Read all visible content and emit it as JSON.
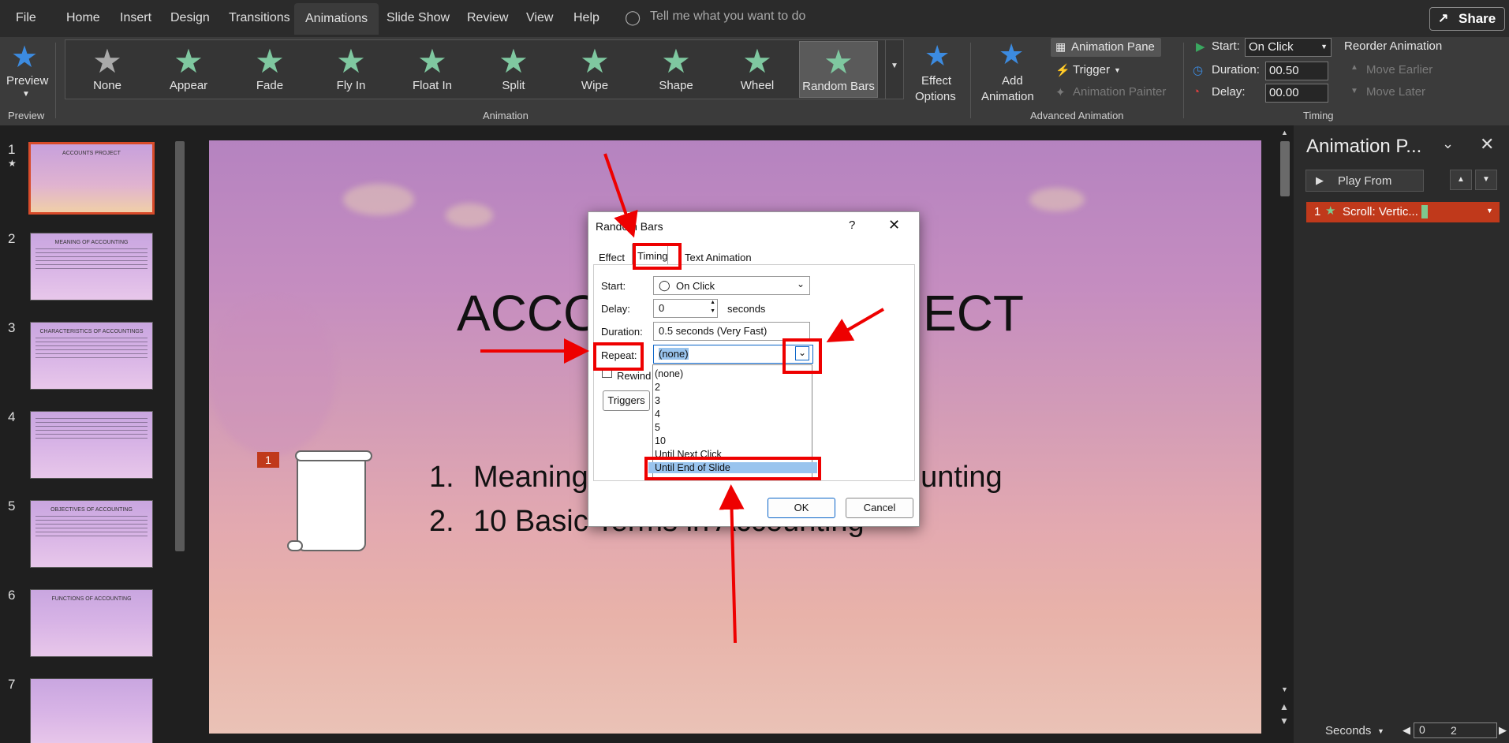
{
  "menubar": {
    "file": "File",
    "tabs": [
      "Home",
      "Insert",
      "Design",
      "Transitions",
      "Animations",
      "Slide Show",
      "Review",
      "View",
      "Help"
    ],
    "tell_me": "Tell me what you want to do",
    "share": "Share"
  },
  "ribbon": {
    "preview": {
      "label": "Preview",
      "group": "Preview"
    },
    "effects": [
      "None",
      "Appear",
      "Fade",
      "Fly In",
      "Float In",
      "Split",
      "Wipe",
      "Shape",
      "Wheel",
      "Random Bars"
    ],
    "effect_options": [
      "Effect",
      "Options"
    ],
    "animation_group": "Animation",
    "add_animation": [
      "Add",
      "Animation"
    ],
    "animation_pane": "Animation Pane",
    "trigger": "Trigger",
    "animation_painter": "Animation Painter",
    "advanced_group": "Advanced Animation",
    "start_label": "Start:",
    "start_value": "On Click",
    "duration_label": "Duration:",
    "duration_value": "00.50",
    "delay_label": "Delay:",
    "delay_value": "00.00",
    "reorder": "Reorder Animation",
    "move_earlier": "Move Earlier",
    "move_later": "Move Later",
    "timing_group": "Timing"
  },
  "slides": [
    {
      "num": "1",
      "title": "ACCOUNTS PROJECT"
    },
    {
      "num": "2",
      "title": "MEANING OF ACCOUNTING"
    },
    {
      "num": "3",
      "title": "CHARACTERISTICS OF ACCOUNTINGS"
    },
    {
      "num": "4",
      "title": ""
    },
    {
      "num": "5",
      "title": "OBJECTIVES OF ACCOUNTING"
    },
    {
      "num": "6",
      "title": "FUNCTIONS OF ACCOUNTING"
    },
    {
      "num": "7",
      "title": ""
    }
  ],
  "slide": {
    "title_left": "ACCO",
    "title_right": "ECT",
    "bullet1_num": "1.",
    "bullet1_left": "Meaning",
    "bullet1_right": "ounting",
    "bullet2_num": "2.",
    "bullet2_left": "10 Basic Terms in Accounting",
    "anim_badge": "1"
  },
  "animation_pane": {
    "title": "Animation P...",
    "play_from": "Play From",
    "item_num": "1",
    "item_label": "Scroll: Vertic..."
  },
  "status": {
    "seconds": "Seconds",
    "zero": "0",
    "two": "2"
  },
  "dialog": {
    "title": "Random Bars",
    "help": "?",
    "tabs": [
      "Effect",
      "Timing",
      "Text Animation"
    ],
    "start_label": "Start:",
    "start_value": "On Click",
    "delay_label": "Delay:",
    "delay_value": "0",
    "delay_unit": "seconds",
    "duration_label": "Duration:",
    "duration_value": "0.5 seconds (Very Fast)",
    "repeat_label": "Repeat:",
    "repeat_value": "(none)",
    "rewind_label": "Rewind",
    "triggers_label": "Triggers",
    "repeat_options": [
      "(none)",
      "2",
      "3",
      "4",
      "5",
      "10",
      "Until Next Click",
      "Until End of Slide"
    ],
    "ok": "OK",
    "cancel": "Cancel"
  }
}
